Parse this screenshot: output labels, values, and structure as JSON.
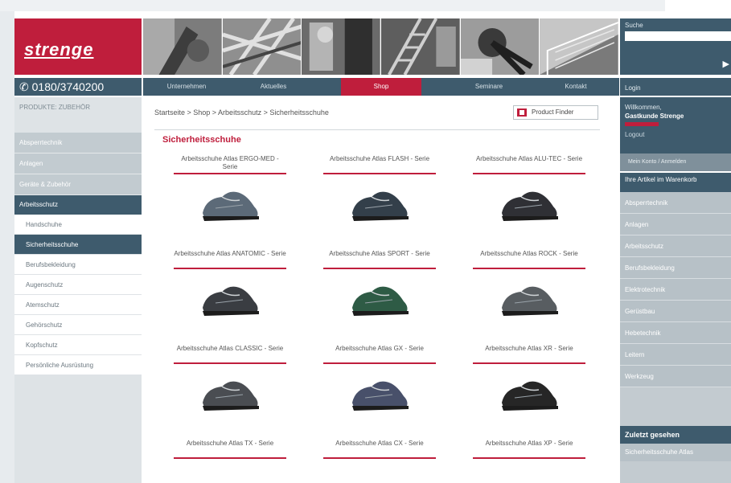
{
  "logo": "strenge",
  "search": {
    "label": "Suche",
    "go": "▶"
  },
  "phone": "✆ 0180/3740200",
  "nav": {
    "items": [
      "Unternehmen",
      "Aktuelles",
      "Shop",
      "Seminare",
      "Kontakt"
    ]
  },
  "left_sidebar": {
    "title": "PRODUKTE: ZUBEHÖR",
    "groups": [
      "Absperrtechnik",
      "Anlagen",
      "Geräte & Zubehör"
    ],
    "active_group": "Arbeitsschutz",
    "subitems": [
      "Handschuhe",
      "Sicherheitsschuhe",
      "Berufsbekleidung",
      "Augenschutz",
      "Atemschutz",
      "Gehörschutz",
      "Kopfschutz",
      "Persönliche Ausrüstung"
    ],
    "selected_index": 1
  },
  "right_sidebar": {
    "login_label": "Login",
    "welcome": "Willkommen,",
    "user": "Gastkunde Strenge",
    "logout": "Logout",
    "account": "Mein Konto / Anmelden",
    "cart_header": "Ihre Artikel im Warenkorb",
    "items": [
      "Absperrtechnik",
      "Anlagen",
      "Arbeitsschutz",
      "Berufsbekleidung",
      "Elektrotechnik",
      "Gerüstbau",
      "Hebetechnik",
      "Leitern",
      "Werkzeug"
    ],
    "recent_header": "Zuletzt gesehen",
    "recent_item": "Sicherheitsschuhe Atlas"
  },
  "main": {
    "breadcrumb": "Startseite > Shop > Arbeitsschutz > Sicherheitsschuhe",
    "product_finder": "Product Finder",
    "heading": "Sicherheitsschuhe",
    "products": [
      "Arbeitsschuhe Atlas ERGO-MED - Serie",
      "Arbeitsschuhe Atlas FLASH - Serie",
      "Arbeitsschuhe Atlas ALU-TEC - Serie",
      "Arbeitsschuhe Atlas ANATOMIC - Serie",
      "Arbeitsschuhe Atlas SPORT - Serie",
      "Arbeitsschuhe Atlas ROCK - Serie",
      "Arbeitsschuhe Atlas CLASSIC - Serie",
      "Arbeitsschuhe Atlas GX - Serie",
      "Arbeitsschuhe Atlas XR - Serie",
      "Arbeitsschuhe Atlas TX - Serie",
      "Arbeitsschuhe Atlas CX - Serie",
      "Arbeitsschuhe Atlas XP - Serie"
    ]
  },
  "colors": {
    "brand_red": "#bf1e3c",
    "nav_dark": "#3e5b6d",
    "sidebar_gray": "#c2cbd0"
  }
}
